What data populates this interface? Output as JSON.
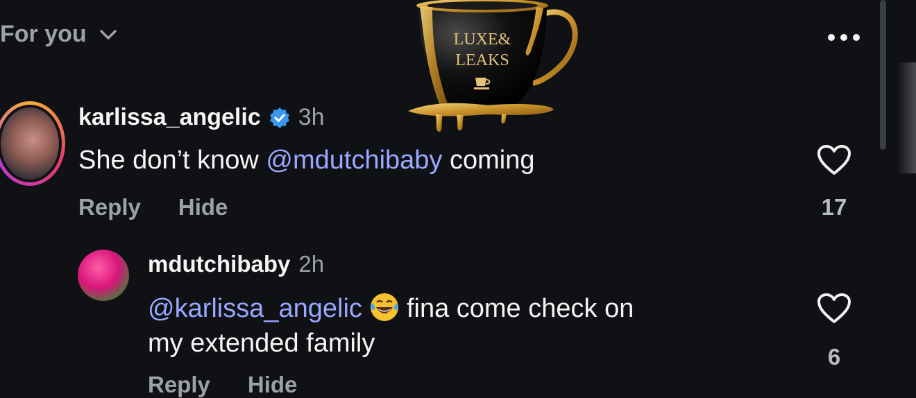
{
  "header": {
    "filter_label": "For you"
  },
  "logo": {
    "line1": "LUXE&",
    "line2": "LEAKS"
  },
  "comments": [
    {
      "username": "karlissa_angelic",
      "verified": true,
      "time": "3h",
      "text_prefix": "She don’t know ",
      "mention": "@mdutchibaby",
      "text_suffix": " coming",
      "actions": {
        "reply": "Reply",
        "hide": "Hide"
      },
      "likes": "17"
    },
    {
      "username": "mdutchibaby",
      "time": "2h",
      "mention": "@karlissa_angelic",
      "emoji": "face-with-tears-of-joy",
      "text_after_emoji": "fina come check on",
      "text_line2": "my extended family",
      "actions": {
        "reply": "Reply",
        "hide": "Hide"
      },
      "likes": "6"
    }
  ],
  "colors": {
    "background": "#0f1115",
    "mention": "#9aa8ff",
    "verified": "#3897f0",
    "muted": "#9ea2a8"
  }
}
